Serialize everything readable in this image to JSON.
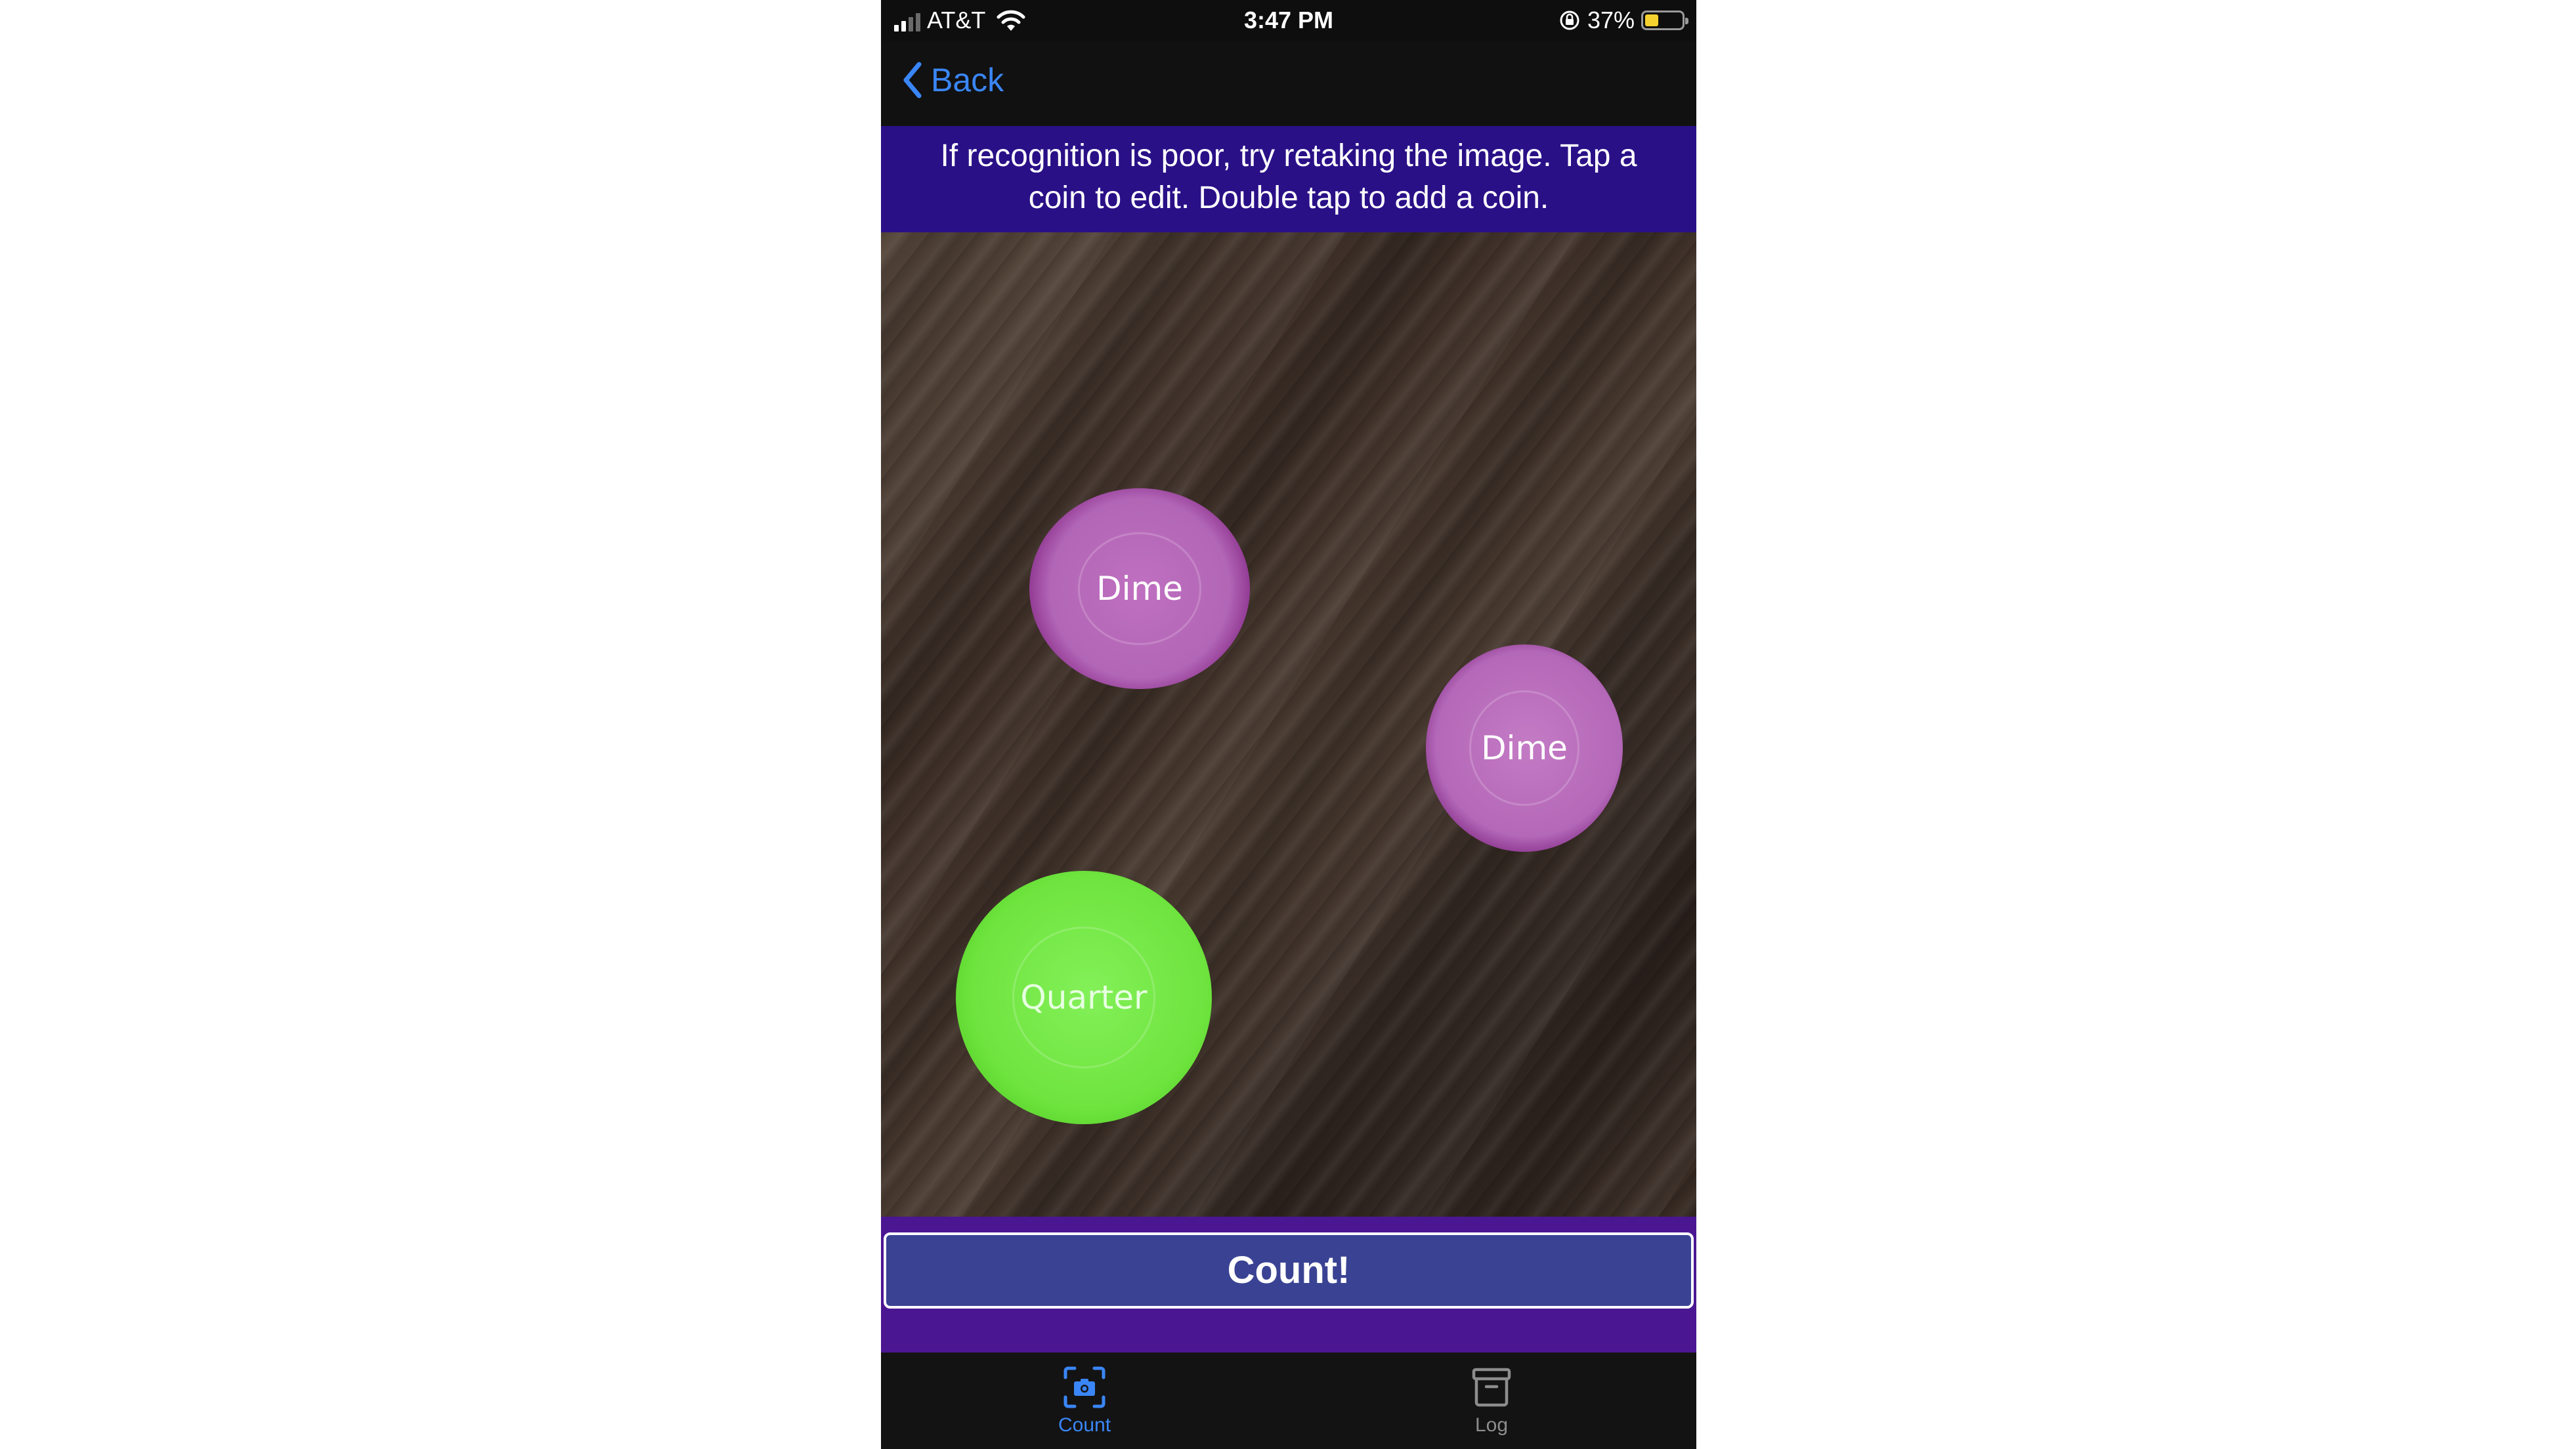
{
  "status_bar": {
    "carrier": "AT&T",
    "time": "3:47 PM",
    "battery": "37%",
    "battery_level": 0.37,
    "icons": [
      "signal-icon",
      "wifi-icon",
      "orientation-lock-icon",
      "battery-icon"
    ]
  },
  "nav": {
    "back_label": "Back",
    "back_icon": "chevron-left-icon",
    "accent_color": "#3a86f6"
  },
  "banner": {
    "text": "If recognition is poor, try retaking the image. Tap a coin to edit. Double tap to add a coin.",
    "background": "#2a1087"
  },
  "photo": {
    "coins": [
      {
        "label": "Dime",
        "color": "#b266b6"
      },
      {
        "label": "Dime",
        "color": "#b468b8"
      },
      {
        "label": "Quarter",
        "color": "#6fe43f"
      }
    ]
  },
  "count": {
    "button_label": "Count!",
    "button_color": "#3a4393",
    "area_color": "#4b1692"
  },
  "tabs": [
    {
      "label": "Count",
      "icon": "camera-icon",
      "selected": true
    },
    {
      "label": "Log",
      "icon": "archive-box-icon",
      "selected": false
    }
  ]
}
